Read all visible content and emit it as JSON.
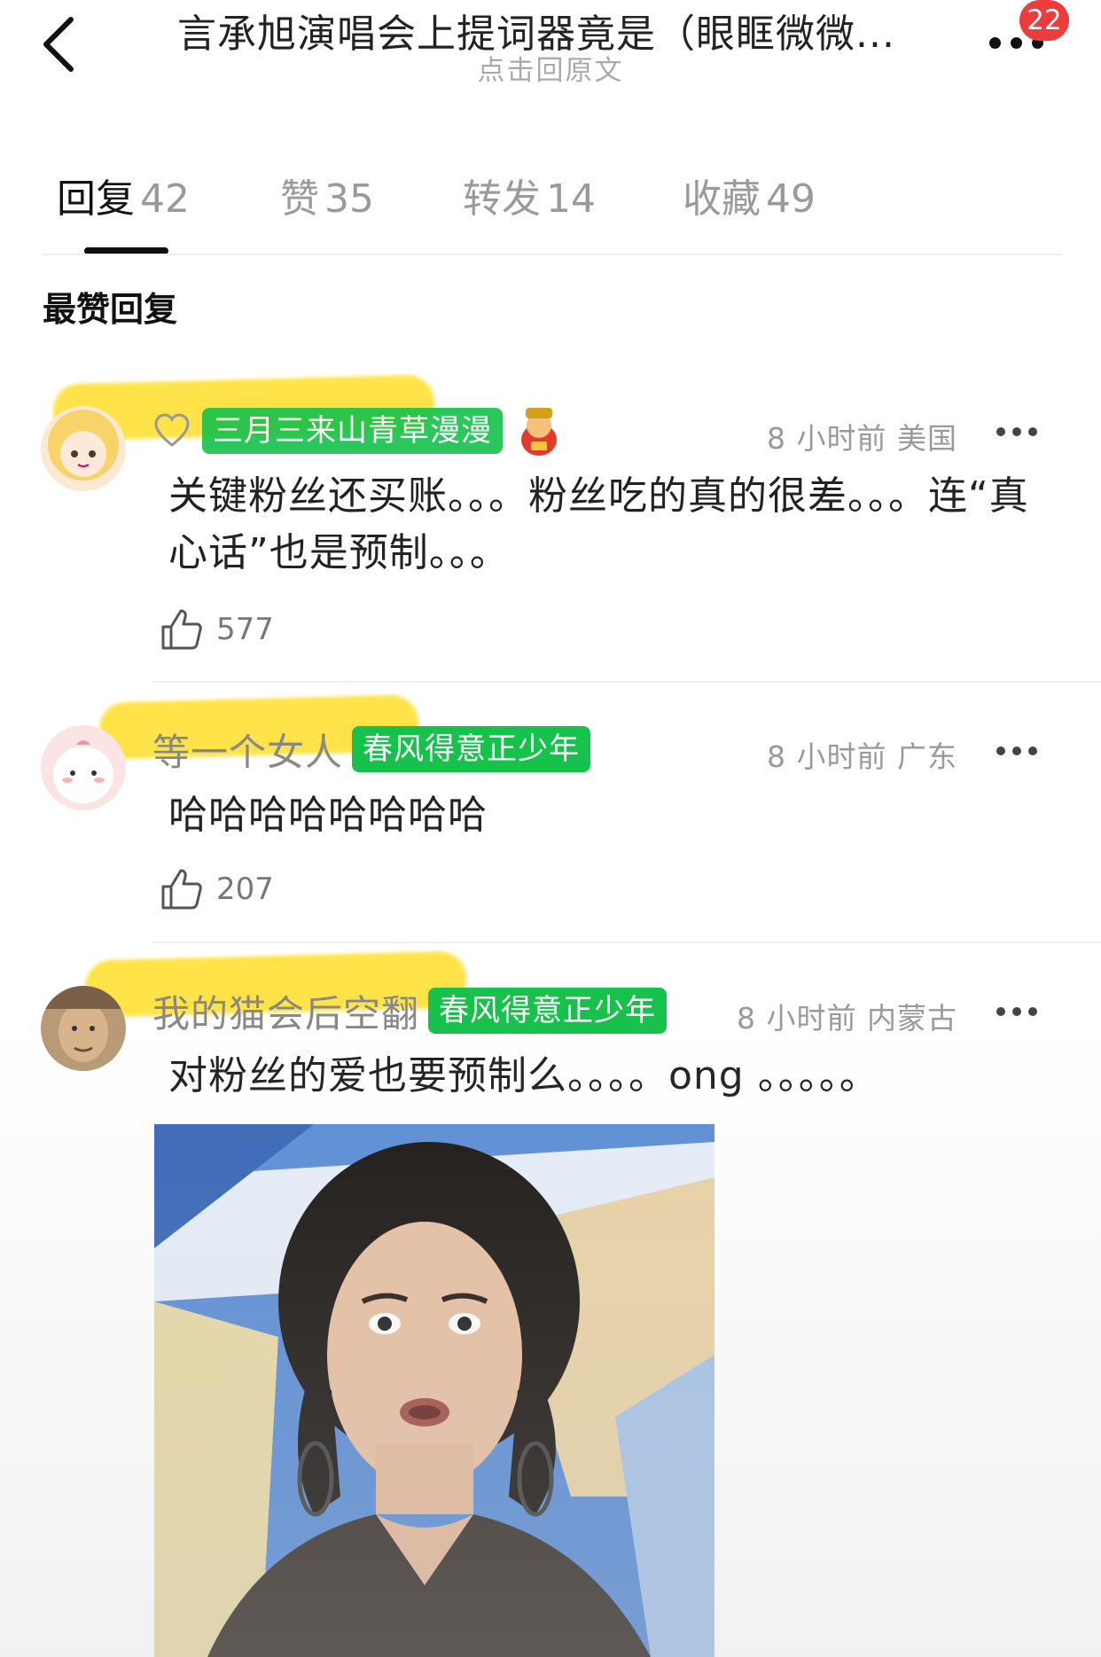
{
  "header": {
    "title": "言承旭演唱会上提词器竟是（眼眶微微...",
    "subtitle": "点击回原文",
    "notification_count": "22"
  },
  "tabs": [
    {
      "label": "回复",
      "count": "42",
      "active": true
    },
    {
      "label": "赞",
      "count": "35",
      "active": false
    },
    {
      "label": "转发",
      "count": "14",
      "active": false
    },
    {
      "label": "收藏",
      "count": "49",
      "active": false
    }
  ],
  "section_title": "最赞回复",
  "comments": [
    {
      "username": "三月三来山青草漫漫",
      "medal": "",
      "time": "8 小时前",
      "location": "美国",
      "text": "关键粉丝还买账。。。粉丝吃的真的很差。。。连“真心话”也是预制。。。",
      "likes": "577"
    },
    {
      "username": "等一个女人",
      "medal": "春风得意正少年",
      "time": "8 小时前",
      "location": "广东",
      "text": "哈哈哈哈哈哈哈哈",
      "likes": "207"
    },
    {
      "username": "我的猫会后空翻",
      "medal": "春风得意正少年",
      "time": "8 小时前",
      "location": "内蒙古",
      "text": "对粉丝的爱也要预制么。。。。ong 。。。。。",
      "likes": ""
    }
  ],
  "colors": {
    "medal_green": "#16c24b",
    "badge_red": "#ee3b3b",
    "highlight_yellow": "#ffde28"
  },
  "icons": {
    "back": "chevron-left-icon",
    "more": "more-dots-icon",
    "heart": "heart-outline-icon",
    "like": "thumbs-up-icon",
    "fan_medal_mascot": "god-of-wealth-emoji"
  }
}
